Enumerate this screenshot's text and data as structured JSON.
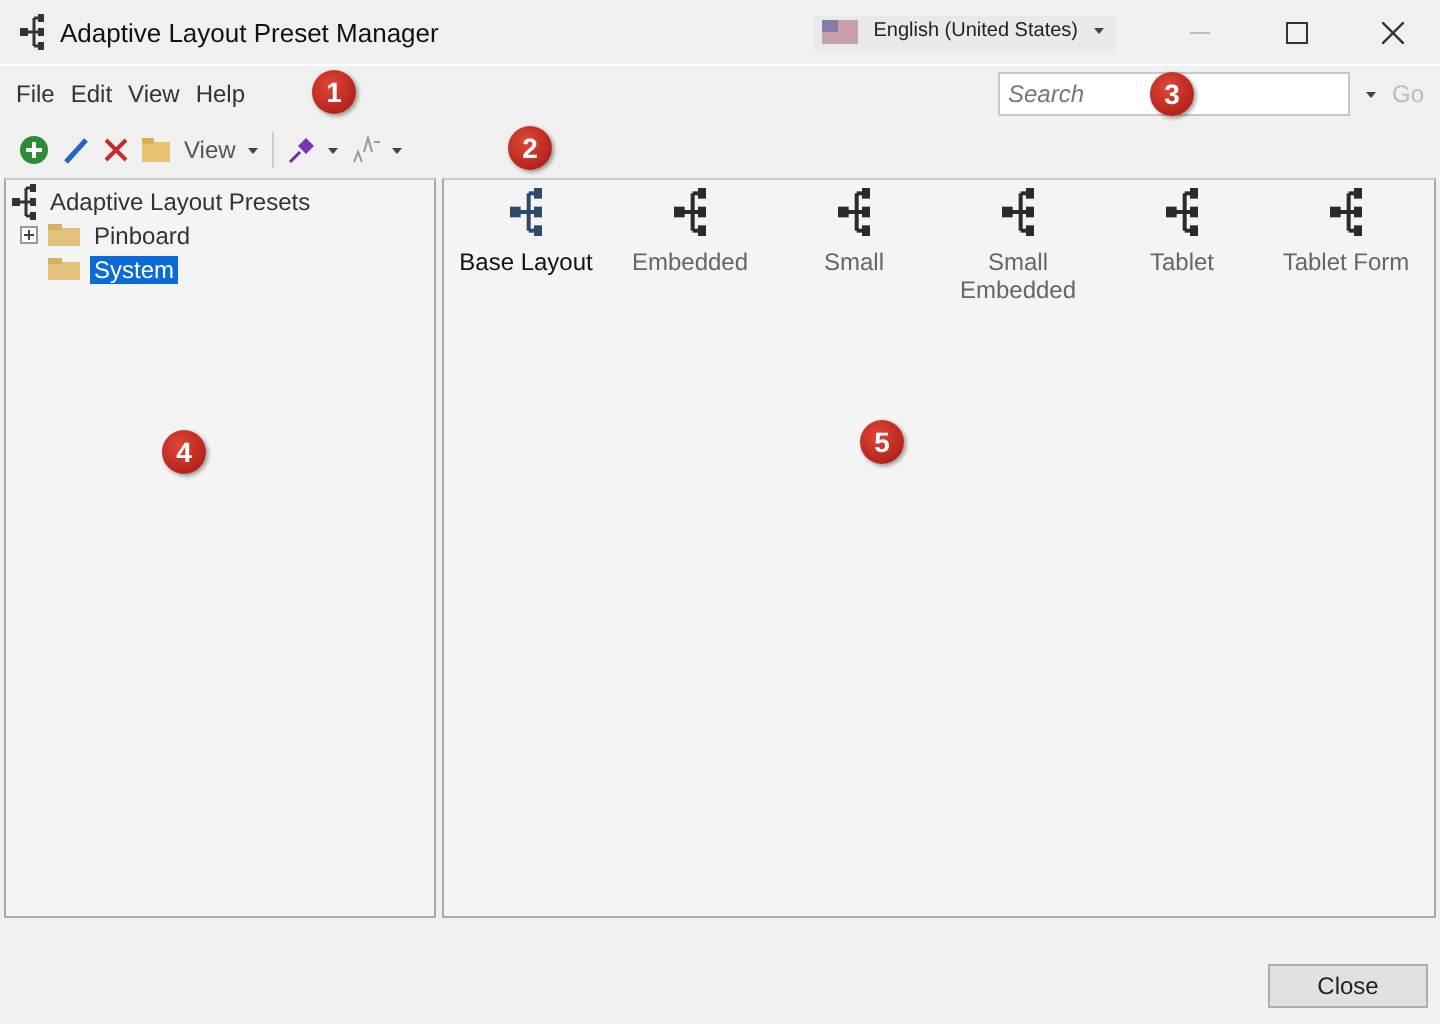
{
  "window": {
    "title": "Adaptive Layout Preset Manager"
  },
  "language": {
    "label": "English (United States)"
  },
  "menu": [
    "File",
    "Edit",
    "View",
    "Help"
  ],
  "search": {
    "placeholder": "Search",
    "go": {
      "label": "Go",
      "disabled": true
    }
  },
  "toolbar": [
    {
      "kind": "add"
    },
    {
      "kind": "edit"
    },
    {
      "kind": "delete"
    },
    {
      "kind": "folder"
    },
    {
      "kind": "menu",
      "label": "View"
    },
    {
      "kind": "separator"
    },
    {
      "kind": "pin"
    },
    {
      "kind": "font"
    }
  ],
  "tree": {
    "label": "Adaptive Layout Presets",
    "children": [
      {
        "label": "Pinboard",
        "expanded": false,
        "selected": false
      },
      {
        "label": "System",
        "selected": true
      }
    ]
  },
  "presets": [
    {
      "label": "Base Layout",
      "selected": true
    },
    {
      "label": "Embedded",
      "selected": false
    },
    {
      "label": "Small",
      "selected": false
    },
    {
      "label": "Small Embedded",
      "selected": false
    },
    {
      "label": "Tablet",
      "selected": false
    },
    {
      "label": "Tablet Form",
      "selected": false
    }
  ],
  "callouts": [
    "1",
    "2",
    "3",
    "4",
    "5"
  ],
  "footer": {
    "button": "Close"
  }
}
